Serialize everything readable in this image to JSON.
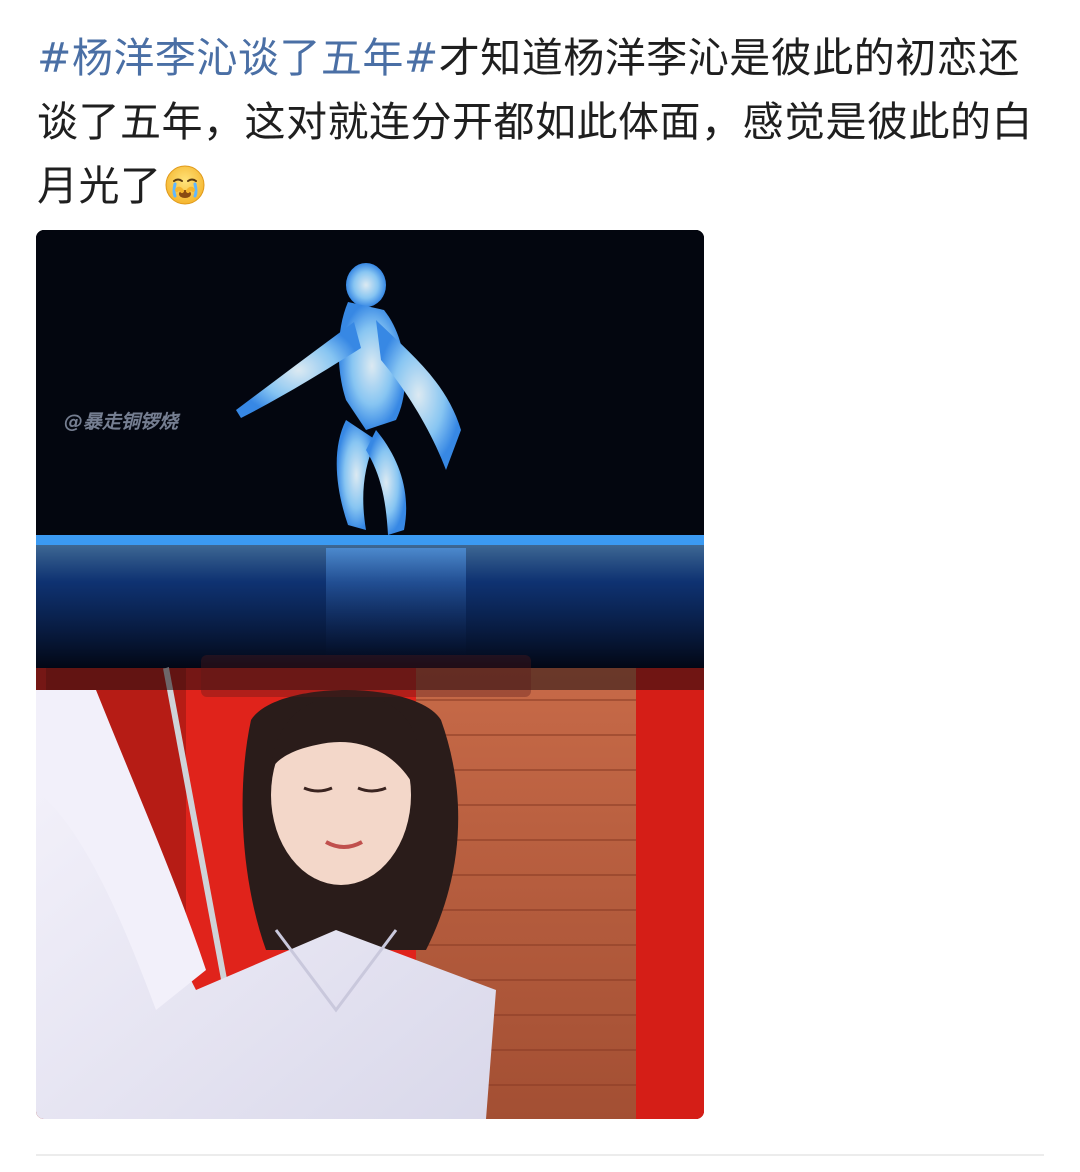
{
  "post": {
    "hashtag": "#杨洋李沁谈了五年#",
    "body": "才知道杨洋李沁是彼此的初恋还谈了五年，这对就连分开都如此体面，感觉是彼此的白月光了",
    "emoji": "crying-face-emoji"
  },
  "media": {
    "watermark_top": "@暴走铜锣烧",
    "colors": {
      "hashtag": "#4a6fa5",
      "stage_glow": "#2f8cff",
      "backdrop_red": "#e8231c",
      "brick": "#b85a3c"
    }
  }
}
